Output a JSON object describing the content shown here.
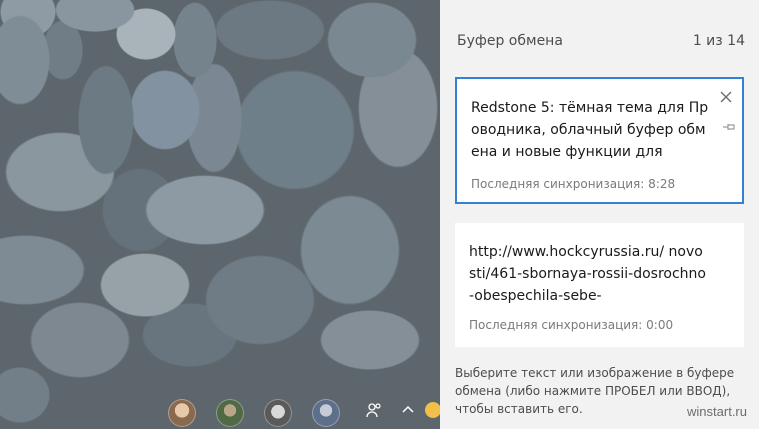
{
  "clipboard": {
    "title": "Буфер обмена",
    "counter": "1 из 14",
    "items": [
      {
        "text": "Redstone 5: тёмная тема для Проводника, облачный буфер обмена и новые функции для",
        "sync": "Последняя синхронизация: 8:28",
        "selected": true,
        "close_icon": "close-icon",
        "pin_icon": "pin-icon"
      },
      {
        "text": "http://www.hockcyrussia.ru/ novosti/461-sbornaya-rossii-dosrochno-obespechila-sebe-",
        "sync": "Последняя синхронизация: 0:00",
        "selected": false
      }
    ],
    "hint": "Выберите текст или изображение в буфере обмена (либо нажмите ПРОБЕЛ или ВВОД), чтобы вставить его.",
    "accent_color": "#2f82d6"
  },
  "taskbar": {
    "icons": [
      "avatar-1",
      "avatar-2",
      "avatar-3",
      "avatar-4",
      "people-icon",
      "chevron-up-icon",
      "emoji-icon"
    ]
  },
  "watermark": "winstart.ru"
}
